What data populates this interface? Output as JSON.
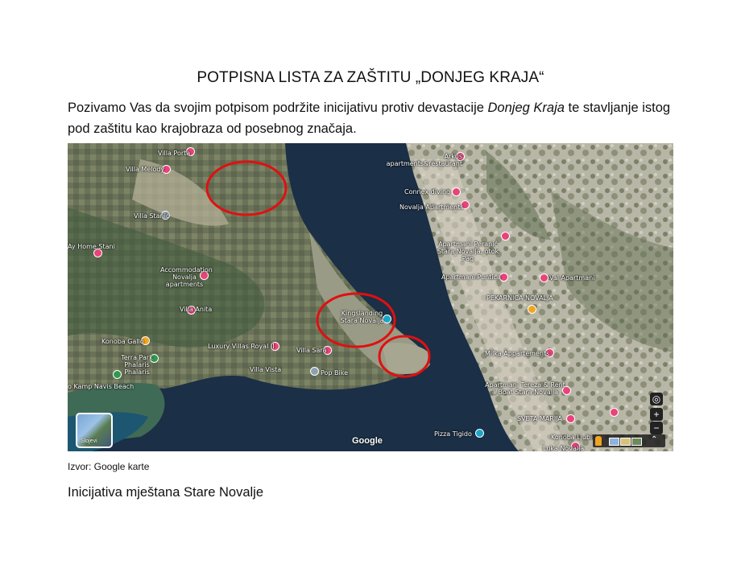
{
  "document": {
    "title": "POTPISNA LISTA ZA ZAŠTITU „DONJEG KRAJA“",
    "intro_before": "Pozivamo Vas da svojim potpisom podržite inicijativu protiv devastacije ",
    "intro_emphasis": "Donjeg Kraja",
    "intro_after": " te stavljanje istog pod zaštitu kao krajobraza od posebnog značaja.",
    "source_note": "Izvor: Google karte",
    "footer": "Inicijativa mještana Stare Novalje"
  },
  "map": {
    "labels": [
      "Villa Porta",
      "Villa Melody",
      "Villa Stanić",
      "Arkus apartments&restaurant",
      "Connex diving",
      "Novalja Apartments",
      "Apartmani Peranić Stara Novalja, otok Pag",
      "Apartmani Puntica",
      "Val Apartmani",
      "PEKARNICA NOVALJA",
      "Ay Home Stani",
      "Accommodation Novalja apartments",
      "Villa Anita",
      "Kingslanding Stara Novalja",
      "Konoba Gallo",
      "Luxury Villas Royal II",
      "Villa Sara",
      "Terra Park Phalaris Phalaris",
      "Villa Vista",
      "Pop Bike",
      "Milka Appartements",
      "o Kamp Navis Beach",
      "Apartmani Tereza & Rent a Boat Stara Novalja",
      "SVETA MARIJA",
      "Konoba Ljubica",
      "Pizza Tigido",
      "Luka Novalja"
    ],
    "google_logo": "Google",
    "layers_label": "Slojevi",
    "colors": {
      "sea": "#1b2f46",
      "land": "#6f7a5e",
      "marker_circle": "#e01010"
    }
  }
}
